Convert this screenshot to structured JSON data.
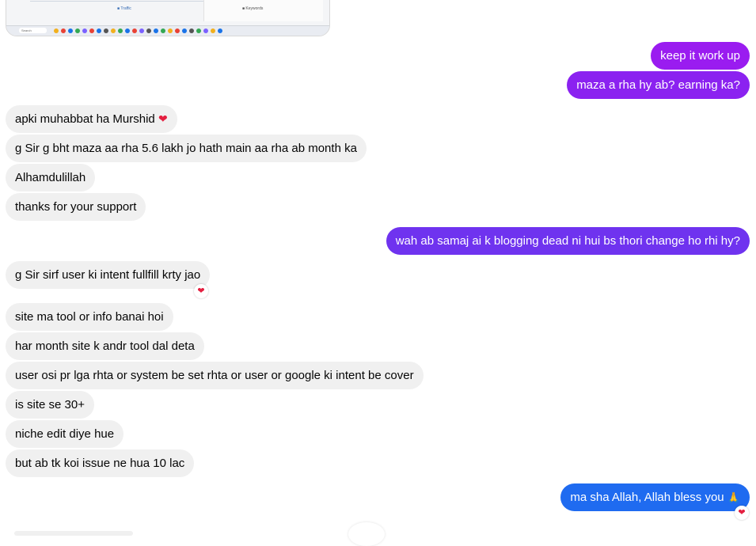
{
  "thumbnail": {
    "legend": "■ Traffic",
    "panel_text": "■ Keywords",
    "search_label": "Search"
  },
  "messages": [
    {
      "side": "out",
      "text": "keep it work up"
    },
    {
      "side": "out",
      "text": "maza a rha hy ab? earning ka?"
    },
    {
      "side": "in",
      "text": "apki muhabbat ha Murshid",
      "emoji": "❤"
    },
    {
      "side": "in",
      "text": "g Sir g bht maza aa rha 5.6 lakh jo hath main aa rha ab month ka"
    },
    {
      "side": "in",
      "text": "Alhamdulillah"
    },
    {
      "side": "in",
      "text": "thanks for your support"
    },
    {
      "side": "out",
      "text": "wah ab samaj ai k blogging dead ni hui bs thori change ho rhi hy?"
    },
    {
      "side": "in",
      "text": "g Sir sirf user ki intent fullfill krty jao",
      "reaction": "❤"
    },
    {
      "side": "in",
      "text": "site ma tool or info banai hoi"
    },
    {
      "side": "in",
      "text": "har month site k andr tool dal deta"
    },
    {
      "side": "in",
      "text": "user osi pr lga rhta or system be set rhta or user or google ki intent be cover"
    },
    {
      "side": "in",
      "text": "is site se 30+"
    },
    {
      "side": "in",
      "text": "niche edit diye hue"
    },
    {
      "side": "in",
      "text": "but ab tk koi issue ne hua 10 lac"
    },
    {
      "side": "out",
      "text": "ma sha Allah, Allah bless you",
      "emoji": "🙏",
      "reaction": "❤"
    }
  ],
  "colors": {
    "incoming_bg": "#f0f0f0",
    "out_purple_1": "#9a1cf0",
    "out_purple_2": "#8b22f0",
    "out_purple_3": "#6f33ef",
    "out_blue": "#1f6bf0"
  }
}
